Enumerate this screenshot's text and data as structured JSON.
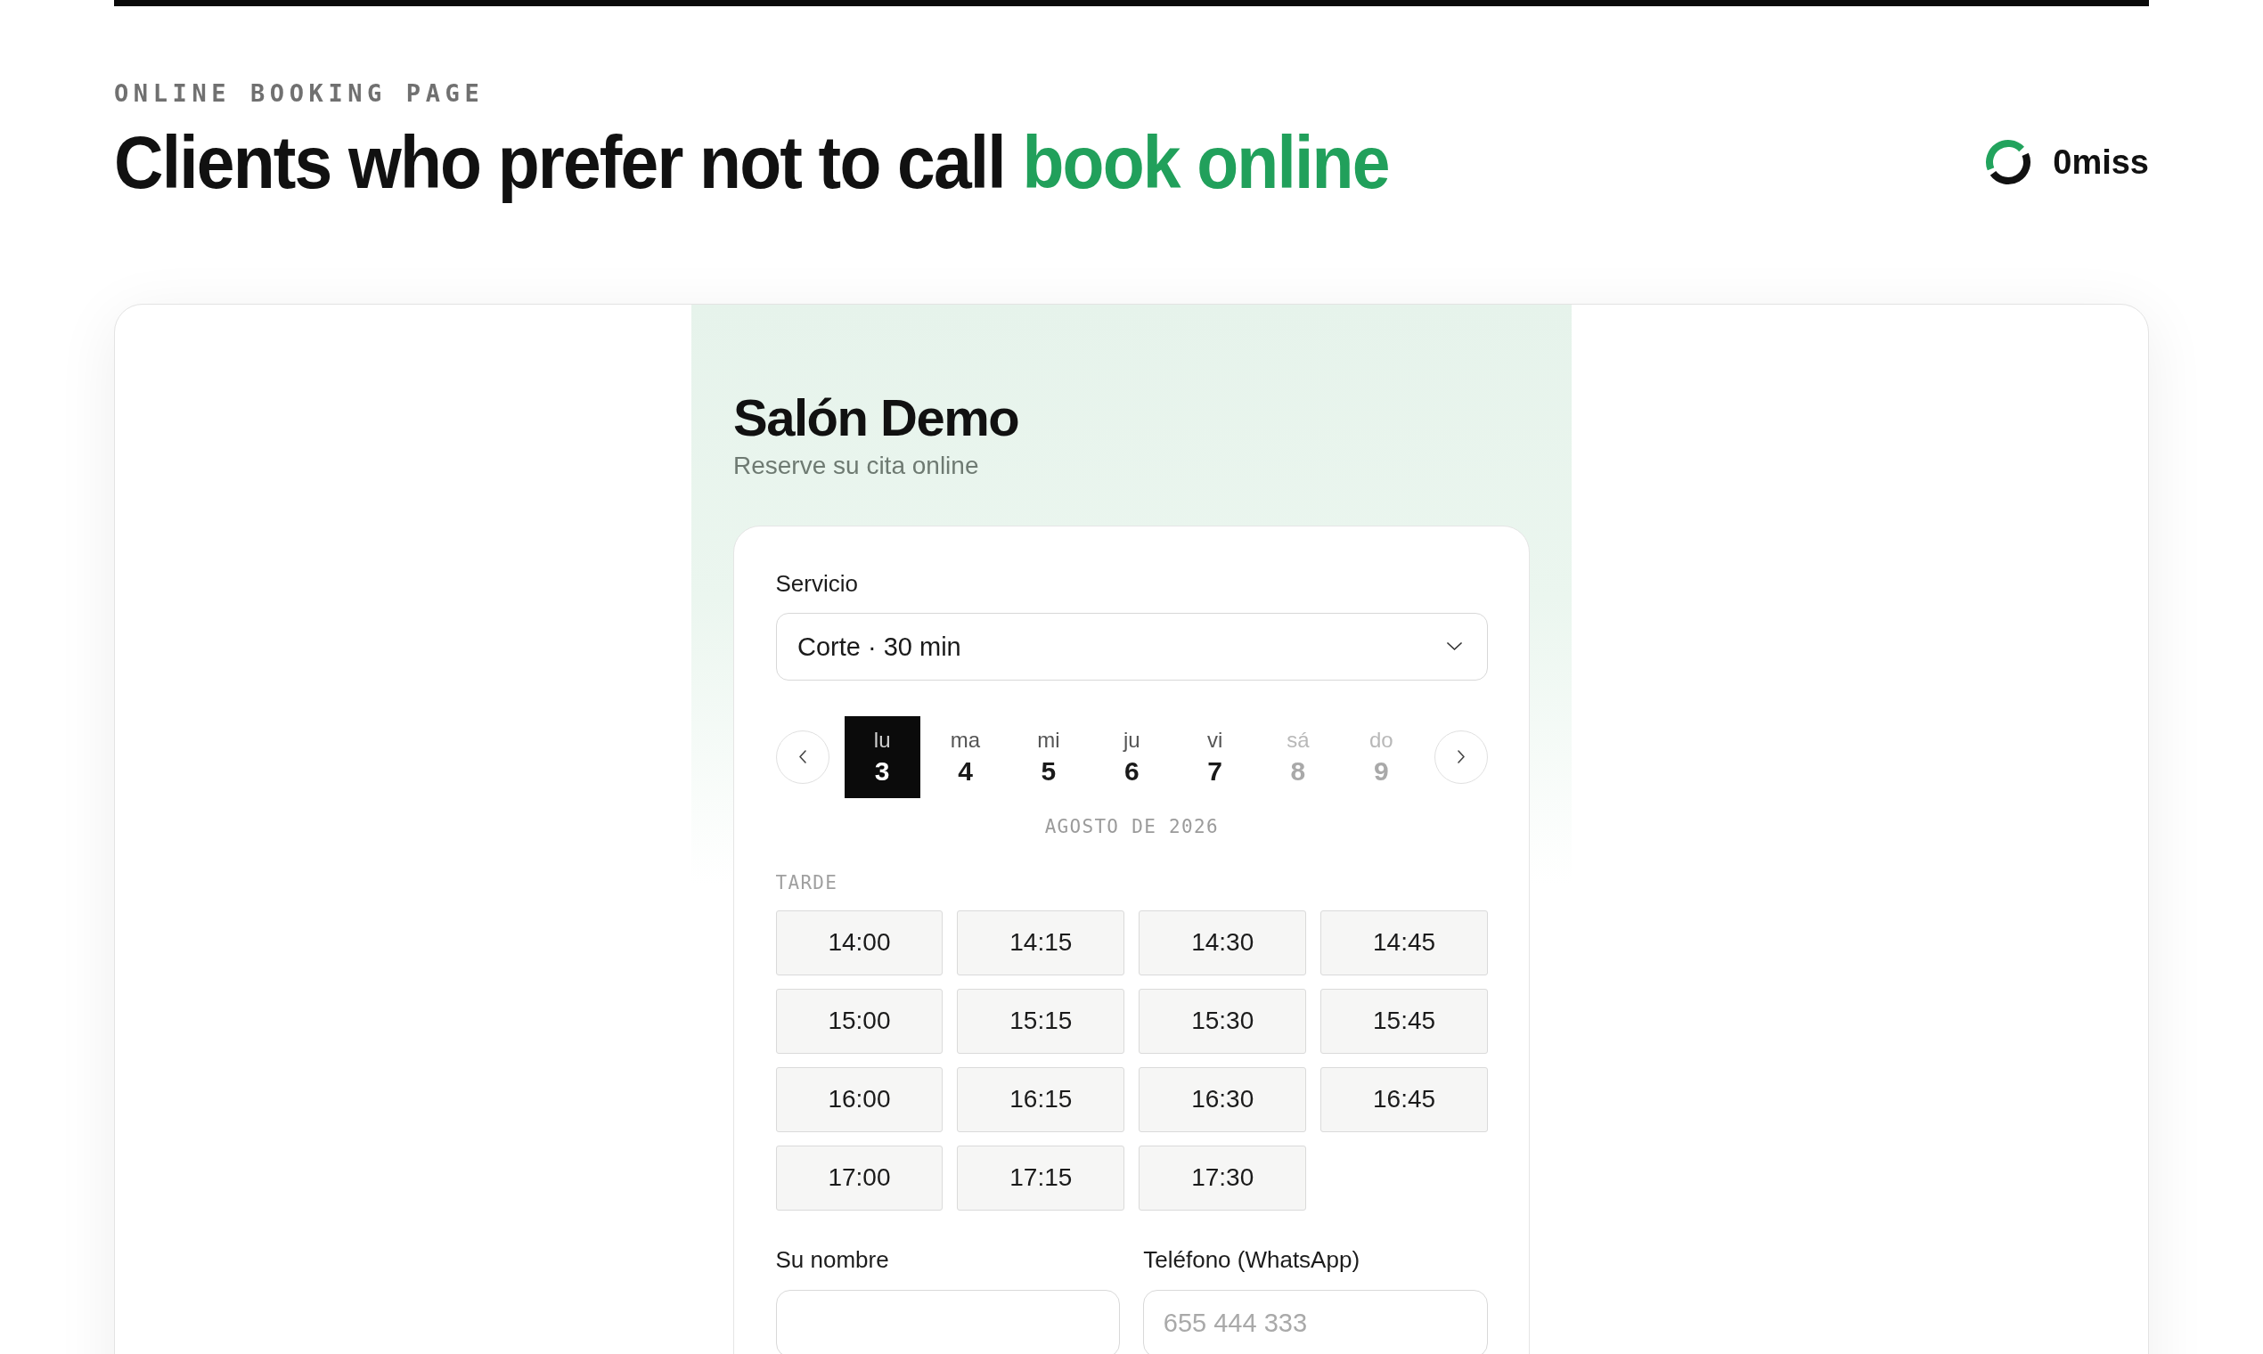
{
  "header": {
    "eyebrow": "ONLINE BOOKING PAGE",
    "headline": "Clients who prefer not to call",
    "headline_highlight": "book online"
  },
  "brand": {
    "name": "0miss"
  },
  "booking": {
    "business_name": "Salón Demo",
    "tagline": "Reserve su cita online",
    "service": {
      "label": "Servicio",
      "value": "Corte · 30 min"
    },
    "days": [
      {
        "weekday": "lu",
        "date": "3",
        "selected": true,
        "disabled": false
      },
      {
        "weekday": "ma",
        "date": "4",
        "selected": false,
        "disabled": false
      },
      {
        "weekday": "mi",
        "date": "5",
        "selected": false,
        "disabled": false
      },
      {
        "weekday": "ju",
        "date": "6",
        "selected": false,
        "disabled": false
      },
      {
        "weekday": "vi",
        "date": "7",
        "selected": false,
        "disabled": false
      },
      {
        "weekday": "sá",
        "date": "8",
        "selected": false,
        "disabled": true
      },
      {
        "weekday": "do",
        "date": "9",
        "selected": false,
        "disabled": true
      }
    ],
    "month": "AGOSTO DE 2026",
    "period": "TARDE",
    "slots": [
      {
        "time": "14:00",
        "selected": false
      },
      {
        "time": "14:15",
        "selected": false
      },
      {
        "time": "14:30",
        "selected": false
      },
      {
        "time": "14:45",
        "selected": false
      },
      {
        "time": "15:00",
        "selected": false
      },
      {
        "time": "15:15",
        "selected": false
      },
      {
        "time": "15:30",
        "selected": false
      },
      {
        "time": "15:45",
        "selected": false
      },
      {
        "time": "16:00",
        "selected": false
      },
      {
        "time": "16:15",
        "selected": false
      },
      {
        "time": "16:30",
        "selected": false
      },
      {
        "time": "16:45",
        "selected": false
      },
      {
        "time": "17:00",
        "selected": false
      },
      {
        "time": "17:15",
        "selected": false
      },
      {
        "time": "17:30",
        "selected": false
      }
    ],
    "fields": [
      {
        "label": "Su nombre"
      },
      {
        "label": "Teléfono (WhatsApp)",
        "placeholder": "655 444 333"
      }
    ]
  }
}
